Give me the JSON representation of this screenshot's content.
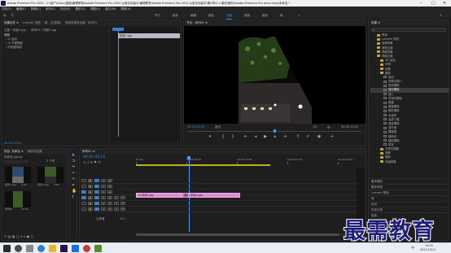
{
  "window": {
    "title": "Adobe Premiere Pro 2020 - C:\\用户\\Ichou\\桌面\\最需教育\\Adobe Premiere Pro 2020 从新手到高手\\最需教育\\Adobe Premiere Pro 2020 从新手到高手\\第2章\\2.4 素材\\素材\\Adobe Premiere Pro Auto-Save\\未命名 *"
  },
  "menu": [
    "文件(F)",
    "编辑(E)",
    "剪辑(C)",
    "序列(S)",
    "标记(M)",
    "图形(G)",
    "视图(V)",
    "窗口(W)",
    "帮助(H)"
  ],
  "workspaces": [
    "学习",
    "组件",
    "编辑",
    "颜色",
    "效果",
    "音频",
    "图形",
    "库",
    "»"
  ],
  "active_workspace": "效果",
  "source_panel": {
    "tabs": [
      "效果控件 ≡",
      "Lumetri 范围",
      "源：(无剪辑)",
      "音频剪辑混合器：序列01"
    ],
    "master_label": "主要 * 风景1.jpg",
    "seq_label": "序列01 * 风景1.jpg",
    "section": "视频",
    "rows": [
      "› fx 运动",
      "› fx 不透明度",
      "› 时间重映射"
    ],
    "clip_name": "风景1.jpg",
    "timecode": "00:00:05:01"
  },
  "program": {
    "title": "节目：序列01 ≡",
    "timecode_left": "00:00:05:01",
    "fit": "适合",
    "ratio": "1/2",
    "timecode_right": "00:00:10:01"
  },
  "project": {
    "tabs": [
      "项目: 未命名 ≡",
      "媒体浏览器"
    ],
    "name": "未命名.prproj",
    "count": "3 个项",
    "items": [
      {
        "name": "风景1.jpg",
        "dur": "5:00"
      },
      {
        "name": "风景2.jpg",
        "dur": "5:00"
      },
      {
        "name": "序列01",
        "dur": "10:01"
      }
    ]
  },
  "timeline": {
    "title": "序列01 ≡",
    "timecode": "00:00:05:01",
    "ruler": [
      "00:00",
      "00:00:05:00",
      "00:00:10:00",
      "00:00:15:00",
      "00:00:20:00"
    ],
    "tracks": [
      {
        "name": "V3",
        "ctl": "V3"
      },
      {
        "name": "V2",
        "ctl": "V2"
      },
      {
        "name": "V1",
        "ctl": "V1",
        "src": "V1"
      },
      {
        "name": "A1",
        "ctl": "A1",
        "src": "A1"
      },
      {
        "name": "A2",
        "ctl": "A2"
      },
      {
        "name": "A3",
        "ctl": "A3"
      }
    ],
    "master": "主声道",
    "master_val": "0.0",
    "clips": [
      {
        "label": "fx 风景1.jpg"
      },
      {
        "label": "fx 风景2.jpg"
      }
    ],
    "transition_label": "风"
  },
  "effects": {
    "title": "效果 ≡",
    "tree": [
      {
        "label": "预设",
        "depth": 1,
        "type": "folder"
      },
      {
        "label": "Lumetri 预设",
        "depth": 1,
        "type": "folder"
      },
      {
        "label": "音频效果",
        "depth": 1,
        "type": "folder"
      },
      {
        "label": "音频过渡",
        "depth": 1,
        "type": "folder"
      },
      {
        "label": "视频效果",
        "depth": 1,
        "type": "folder"
      },
      {
        "label": "视频过渡",
        "depth": 1,
        "type": "folder"
      },
      {
        "label": "3D 运动",
        "depth": 2,
        "type": "folder"
      },
      {
        "label": "内滑",
        "depth": 2,
        "type": "folder"
      },
      {
        "label": "划像",
        "depth": 2,
        "type": "folder"
      },
      {
        "label": "擦除",
        "depth": 2,
        "type": "folder"
      },
      {
        "label": "划出",
        "depth": 3,
        "type": "item"
      },
      {
        "label": "双侧平推门",
        "depth": 3,
        "type": "item"
      },
      {
        "label": "带状擦除",
        "depth": 3,
        "type": "item"
      },
      {
        "label": "径向擦除",
        "depth": 3,
        "type": "item",
        "selected": true
      },
      {
        "label": "插入",
        "depth": 3,
        "type": "item"
      },
      {
        "label": "时钟式擦除",
        "depth": 3,
        "type": "item"
      },
      {
        "label": "棋盘",
        "depth": 3,
        "type": "item"
      },
      {
        "label": "棋盘擦除",
        "depth": 3,
        "type": "item"
      },
      {
        "label": "楔形擦除",
        "depth": 3,
        "type": "item"
      },
      {
        "label": "水波块",
        "depth": 3,
        "type": "item"
      },
      {
        "label": "油漆飞溅",
        "depth": 3,
        "type": "item"
      },
      {
        "label": "渐变擦除",
        "depth": 3,
        "type": "item"
      },
      {
        "label": "百叶窗",
        "depth": 3,
        "type": "item"
      },
      {
        "label": "螺旋框",
        "depth": 3,
        "type": "item"
      },
      {
        "label": "随机块",
        "depth": 3,
        "type": "item"
      },
      {
        "label": "随机擦除",
        "depth": 3,
        "type": "item"
      },
      {
        "label": "风车",
        "depth": 3,
        "type": "item"
      },
      {
        "label": "沉浸式视频",
        "depth": 2,
        "type": "folder"
      },
      {
        "label": "溶解",
        "depth": 2,
        "type": "folder"
      },
      {
        "label": "缩放",
        "depth": 2,
        "type": "folder"
      },
      {
        "label": "页面剥落",
        "depth": 2,
        "type": "folder"
      }
    ],
    "lower": [
      "基本图形",
      "基本声音",
      "Lumetri 颜色",
      "库",
      "标记",
      "历史记录",
      "信息"
    ]
  },
  "taskbar": {
    "time": "14:05",
    "date": "2021/10/11",
    "lang": "中"
  },
  "watermark": "最需教育",
  "colors": {
    "accent_blue": "#2d8ceb",
    "clip_pink": "#e08ad6",
    "playhead": "#4a9bff"
  }
}
